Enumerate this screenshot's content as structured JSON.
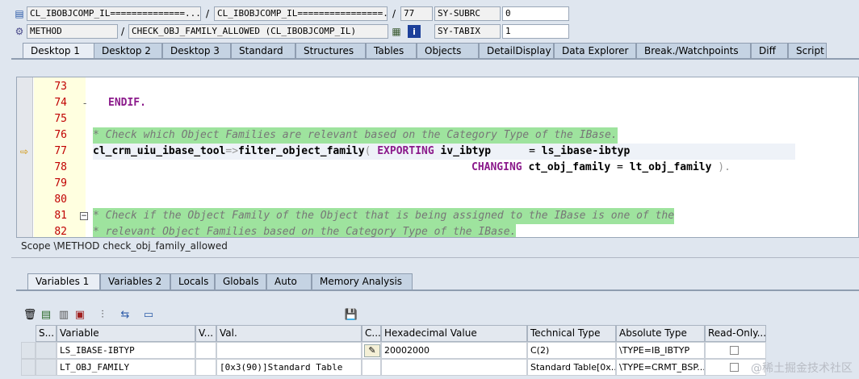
{
  "header": {
    "row1": {
      "program": "CL_IBOBJCOMP_IL==============...",
      "include": "CL_IBOBJCOMP_IL================...",
      "line": "77",
      "field_name": "SY-SUBRC",
      "field_value": "0"
    },
    "row2": {
      "event_type": "METHOD",
      "event_name": "CHECK_OBJ_FAMILY_ALLOWED (CL_IBOBJCOMP_IL)",
      "field_name": "SY-TABIX",
      "field_value": "1"
    },
    "separator": "/"
  },
  "desktop_tabs": [
    "Desktop 1",
    "Desktop 2",
    "Desktop 3",
    "Standard",
    "Structures",
    "Tables",
    "Objects",
    "DetailDisplay",
    "Data Explorer",
    "Break./Watchpoints",
    "Diff",
    "Script"
  ],
  "code": {
    "lines": [
      {
        "n": "73"
      },
      {
        "n": "74",
        "endif": "ENDIF."
      },
      {
        "n": "75"
      },
      {
        "n": "76",
        "comment": "* Check which Object Families are relevant based on the Category Type of the IBase."
      },
      {
        "n": "77",
        "obj": "cl_crm_uiu_ibase_tool",
        "op": "=>",
        "method": "filter_object_family",
        "paren": "(",
        "kw1": "EXPORTING",
        "p1": "iv_ibtyp",
        "eq1": "=",
        "v1": "ls_ibase-ibtyp"
      },
      {
        "n": "78",
        "kw2": "CHANGING",
        "p2": "ct_obj_family",
        "eq2": "=",
        "v2": "lt_obj_family",
        "close": ")."
      },
      {
        "n": "79"
      },
      {
        "n": "80"
      },
      {
        "n": "81",
        "comment": "* Check if the Object Family of the Object that is being assigned to the IBase is one of the"
      },
      {
        "n": "82",
        "comment": "* relevant Object Families based on the Category Type of the IBase."
      }
    ]
  },
  "scope": "Scope \\METHOD check_obj_family_allowed",
  "variable_tabs": [
    "Variables 1",
    "Variables 2",
    "Locals",
    "Globals",
    "Auto",
    "Memory Analysis"
  ],
  "table": {
    "headers": [
      "S...",
      "Variable",
      "V...",
      "Val.",
      "C...",
      "Hexadecimal Value",
      "Technical Type",
      "Absolute Type",
      "Read-Only..."
    ],
    "rows": [
      {
        "variable": "LS_IBASE-IBTYP",
        "val": "",
        "hex": "20002000",
        "tech": "C(2)",
        "abs": "\\TYPE=IB_IBTYP"
      },
      {
        "variable": "LT_OBJ_FAMILY",
        "val": "[0x3(90)]Standard Table",
        "hex": "",
        "tech": "Standard Table[0x...",
        "abs": "\\TYPE=CRMT_BSP..."
      }
    ]
  },
  "watermark": "@稀土掘金技术社区",
  "colors": {
    "accent": "#c5d3e3",
    "comment_bg": "#9ee39e",
    "keyword": "#8b1a8b",
    "line_number": "#c00000"
  }
}
